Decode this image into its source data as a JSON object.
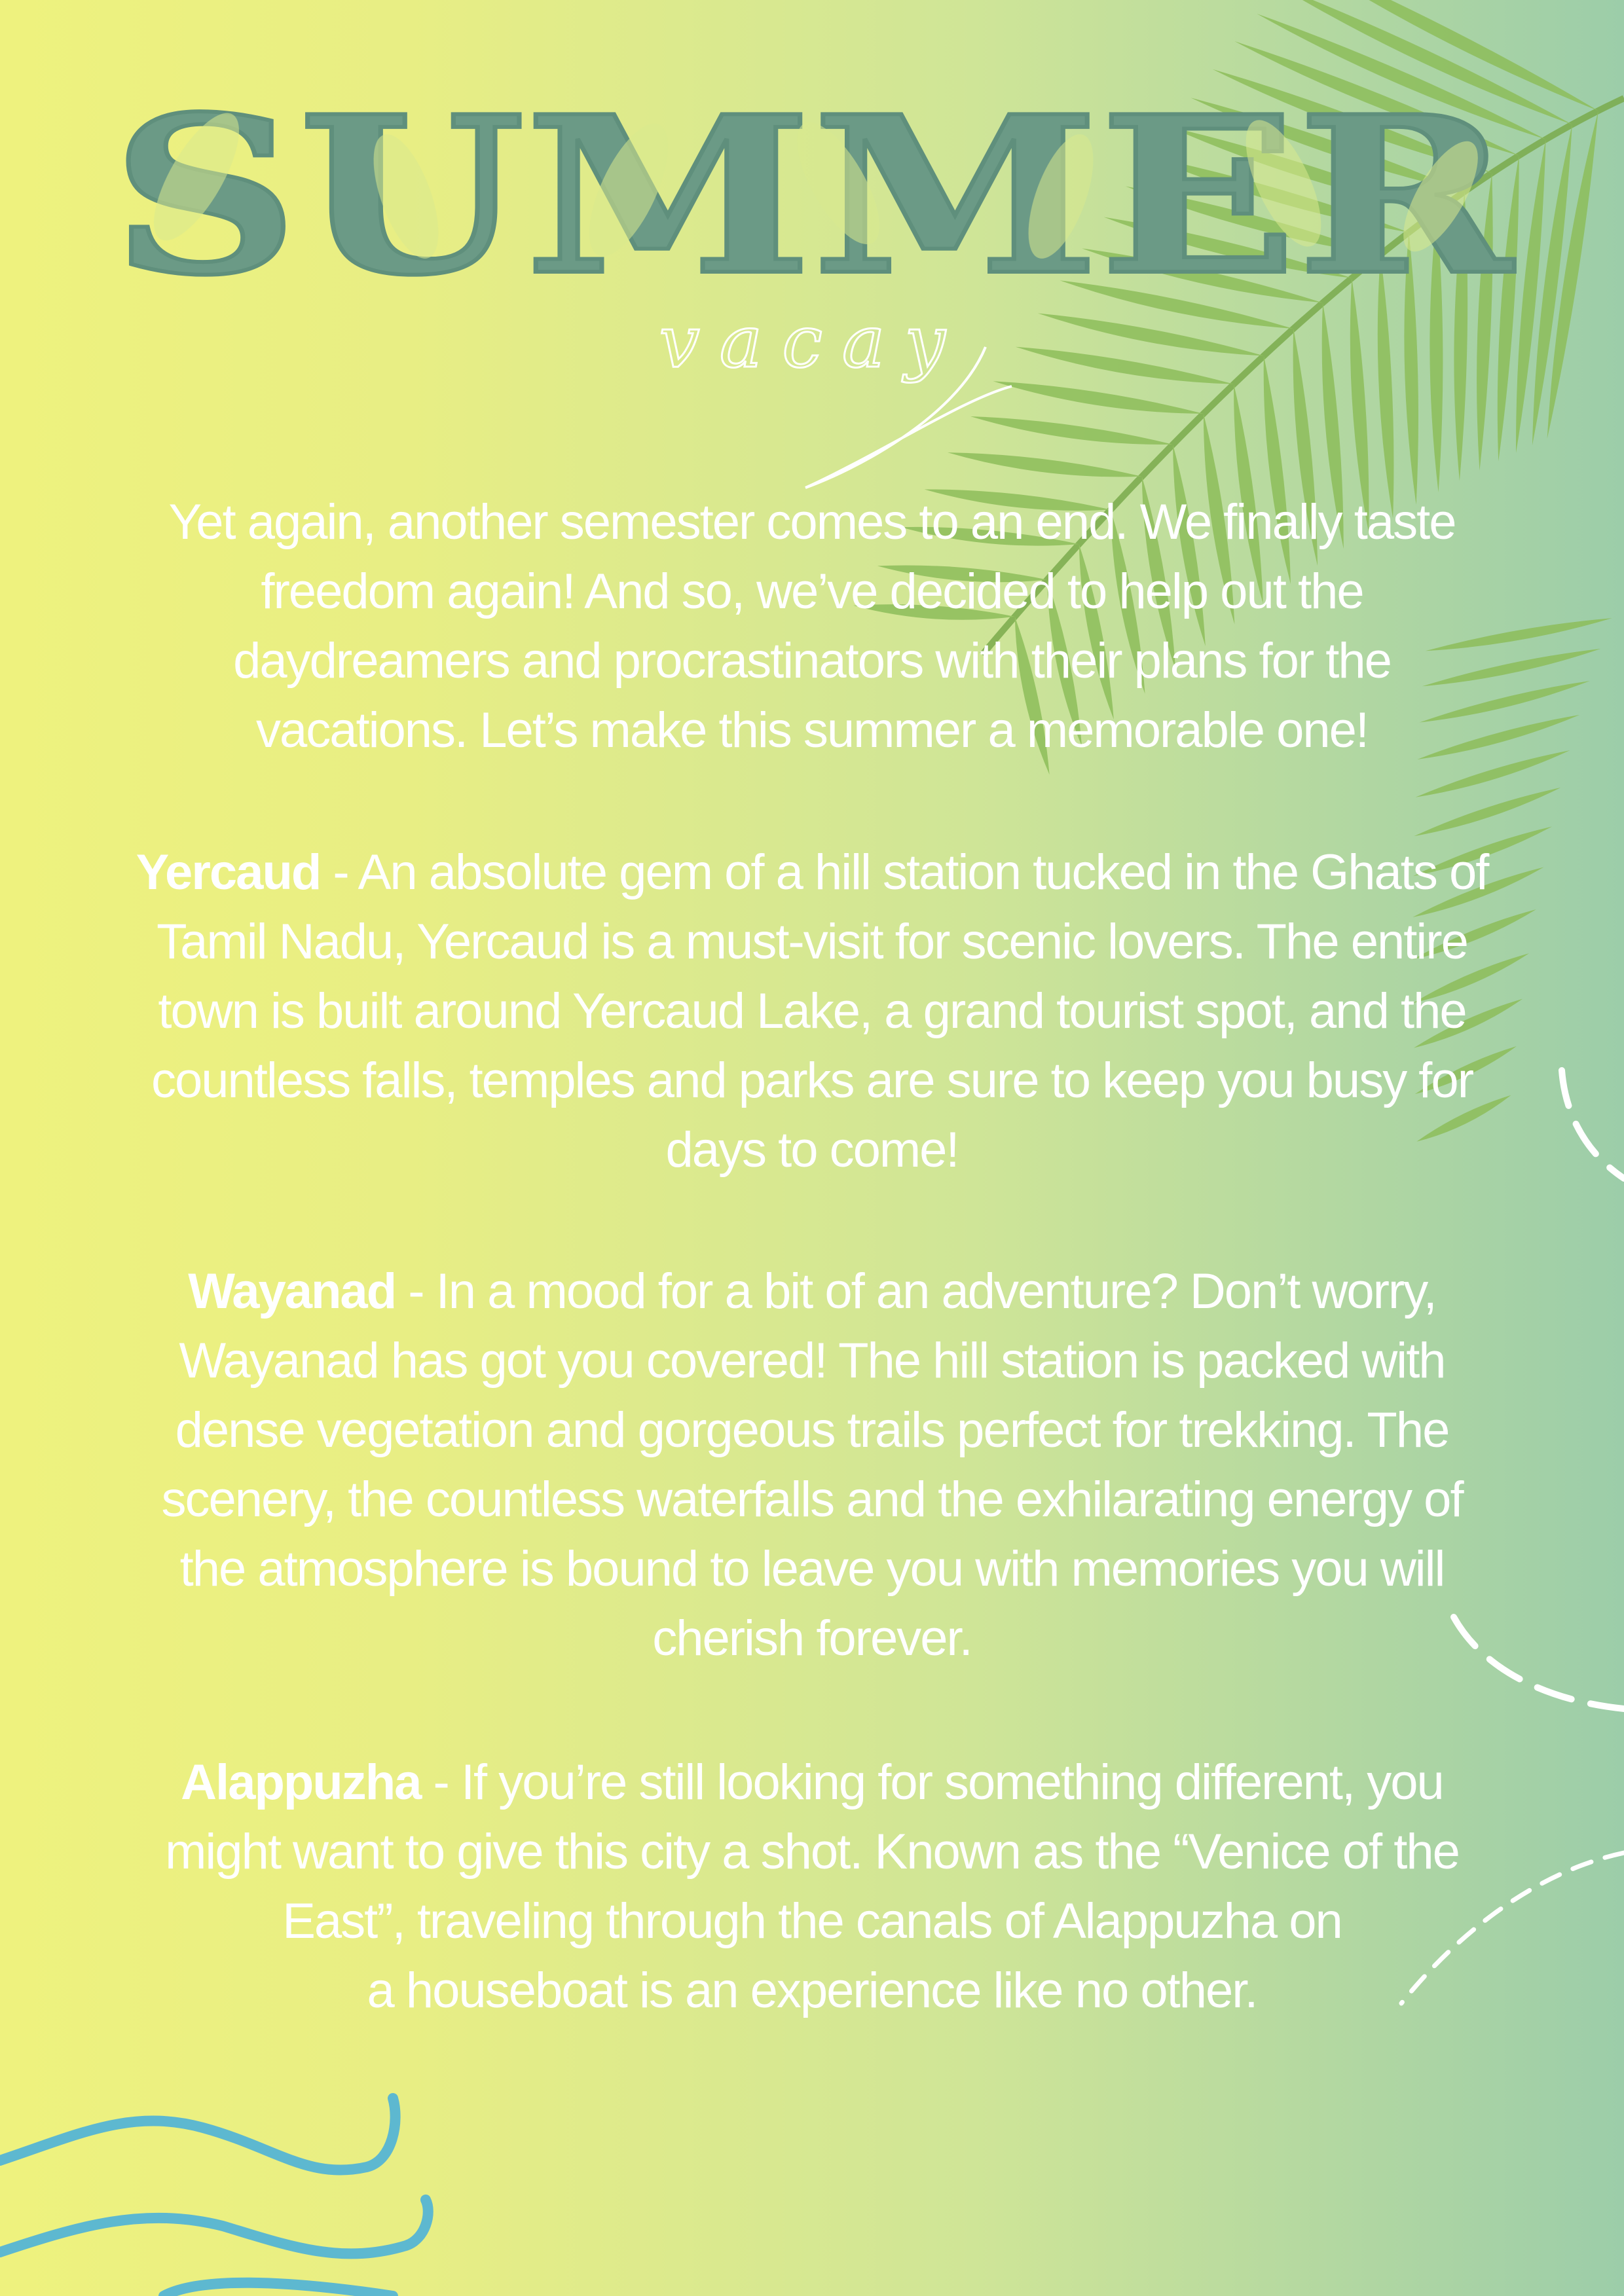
{
  "title": "SUMMER",
  "subtitle": "vacay",
  "intro": {
    "lines": [
      "Yet again, another semester comes to an end. We finally taste",
      "freedom again! And so, we’ve decided to help out the",
      "daydreamers and procrastinators with their plans for the",
      "vacations. Let’s make this summer a memorable one!"
    ]
  },
  "destinations": [
    {
      "name": "Yercaud",
      "first_line_rest": " - An absolute gem of a hill station tucked in the Ghats of",
      "lines": [
        "Tamil Nadu, Yercaud is a must-visit for scenic lovers. The entire",
        "town is built around Yercaud Lake, a grand tourist spot, and the",
        "countless falls, temples and parks are sure to keep you busy for",
        "days to come!"
      ]
    },
    {
      "name": "Wayanad",
      "first_line_rest": " - In a mood for a bit of an adventure? Don’t worry,",
      "lines": [
        "Wayanad has got you covered! The hill station is packed with",
        "dense vegetation and gorgeous trails perfect for trekking. The",
        "scenery, the countless waterfalls and the exhilarating energy of",
        "the atmosphere is bound to leave you with memories you will",
        "cherish forever."
      ]
    },
    {
      "name": "Alappuzha",
      "first_line_rest": " - If you’re still looking for something different, you",
      "lines": [
        "might want to give this city a shot. Known as the “Venice of the",
        "East”, traveling through the canals of Alappuzha on",
        "a houseboat is an experience like no other."
      ]
    }
  ],
  "colors": {
    "title": "#6b9a86",
    "text": "#ffffff",
    "palm": "#8dbd5a",
    "wave": "#5db8d0"
  }
}
